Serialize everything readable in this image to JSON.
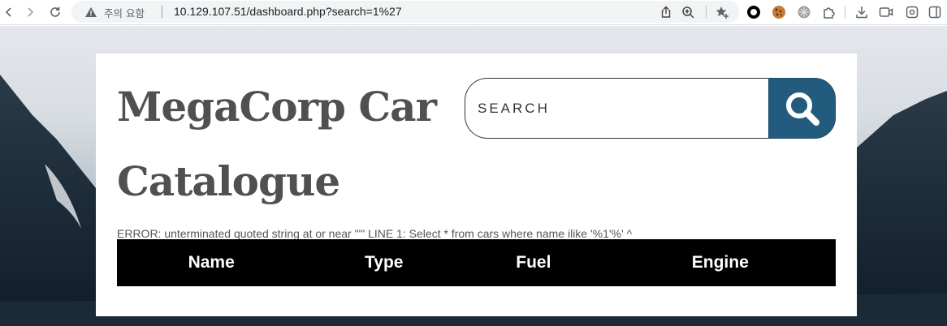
{
  "browser": {
    "security_label": "주의 요함",
    "url": "10.129.107.51/dashboard.php?search=1%27"
  },
  "site": {
    "title_line1": "MegaCorp Car",
    "title_line2": "Catalogue"
  },
  "search": {
    "placeholder": "SEARCH",
    "value": ""
  },
  "error_message": "ERROR: unterminated quoted string at or near \"'\" LINE 1: Select * from cars where name ilike '%1'%' ^",
  "table": {
    "columns": [
      "Name",
      "Type",
      "Fuel",
      "Engine"
    ]
  },
  "colors": {
    "search_button": "#235b7e",
    "table_header_bg": "#000000",
    "title_text": "#505050"
  }
}
